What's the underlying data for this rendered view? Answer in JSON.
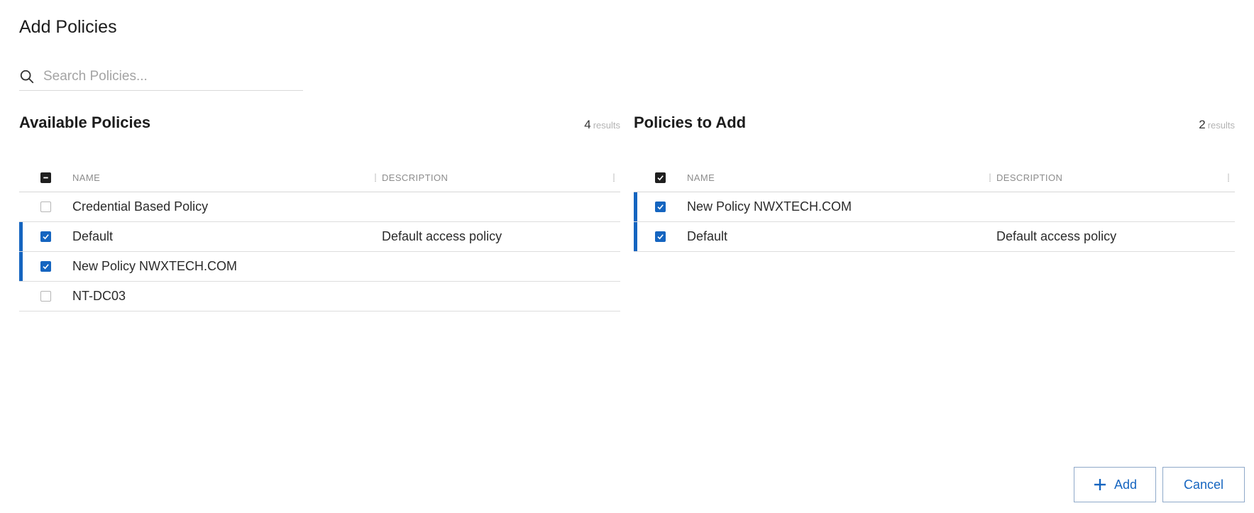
{
  "dialog": {
    "title": "Add Policies"
  },
  "search": {
    "placeholder": "Search Policies..."
  },
  "available": {
    "title": "Available Policies",
    "count": "4",
    "count_suffix": "results",
    "columns": {
      "name": "NAME",
      "description": "DESCRIPTION"
    },
    "rows": [
      {
        "name": "Credential Based Policy",
        "description": "",
        "checked": false
      },
      {
        "name": "Default",
        "description": "Default access policy",
        "checked": true
      },
      {
        "name": "New Policy NWXTECH.COM",
        "description": "",
        "checked": true
      },
      {
        "name": "NT-DC03",
        "description": "",
        "checked": false
      }
    ]
  },
  "to_add": {
    "title": "Policies to Add",
    "count": "2",
    "count_suffix": "results",
    "columns": {
      "name": "NAME",
      "description": "DESCRIPTION"
    },
    "rows": [
      {
        "name": "New Policy NWXTECH.COM",
        "description": "",
        "checked": true
      },
      {
        "name": "Default",
        "description": "Default access policy",
        "checked": true
      }
    ]
  },
  "buttons": {
    "add": "Add",
    "cancel": "Cancel"
  },
  "colors": {
    "accent": "#1565c0",
    "text": "#222222",
    "muted": "#a4a4a4"
  }
}
